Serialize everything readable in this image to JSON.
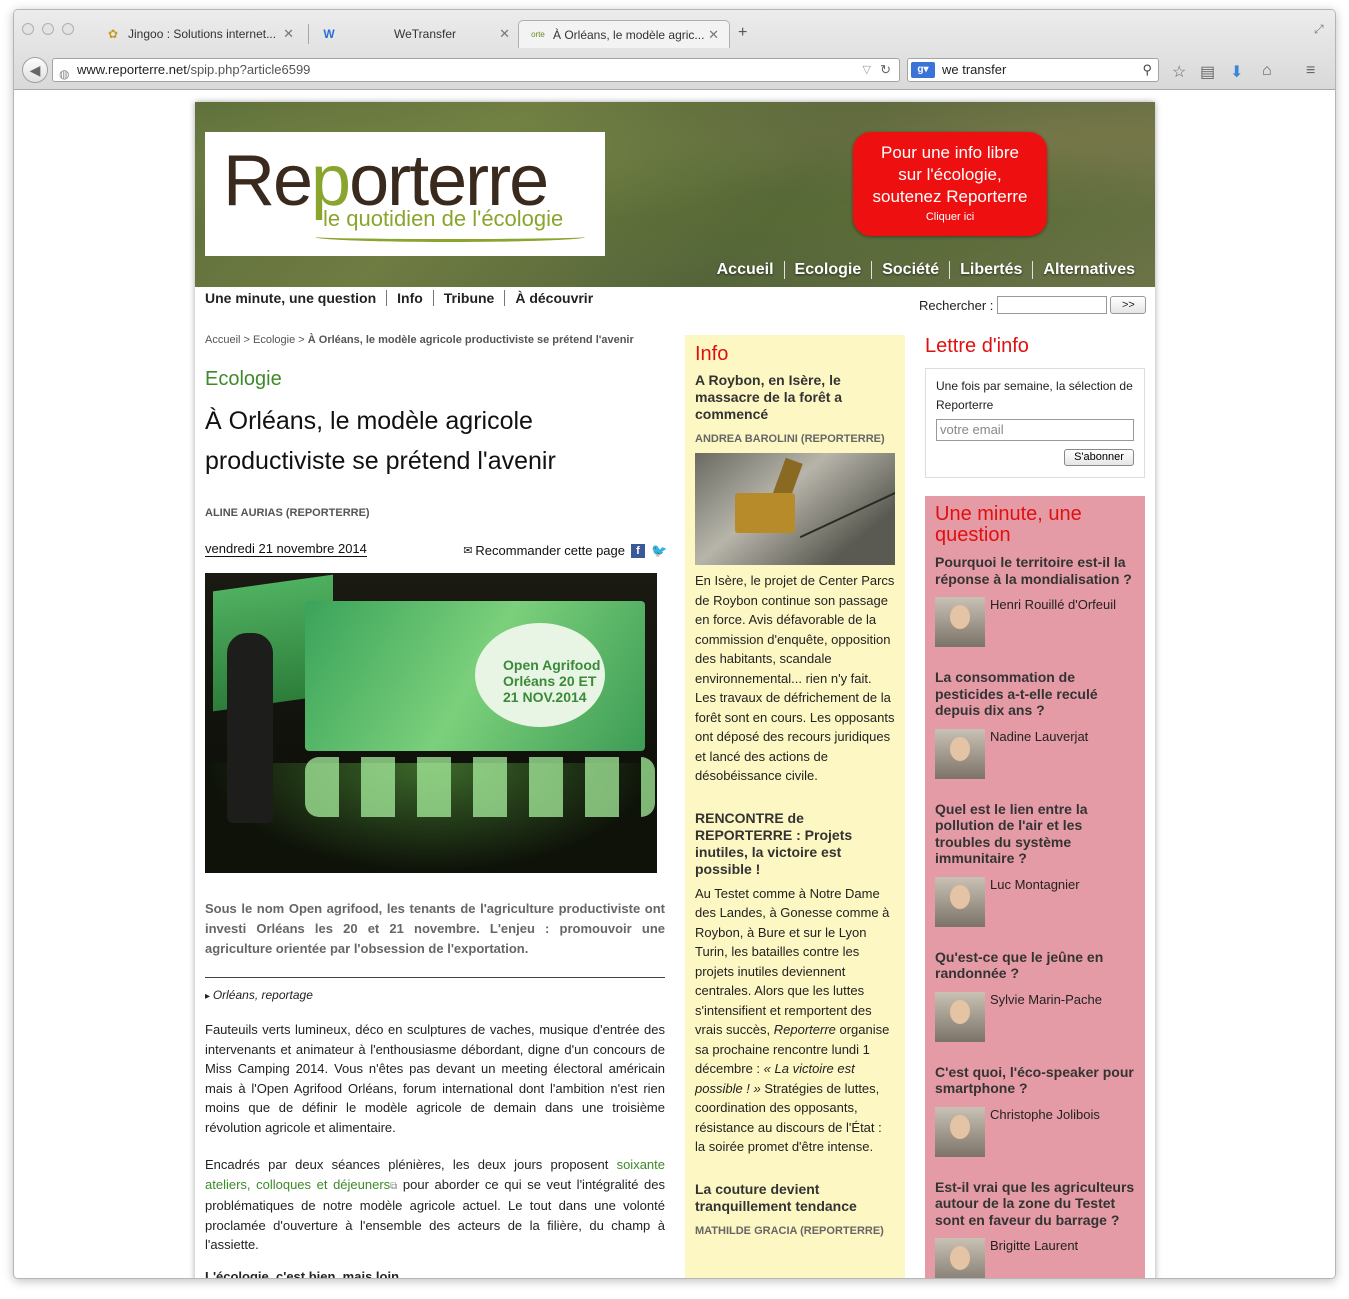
{
  "browser": {
    "tabs": [
      {
        "label": "Jingoo : Solutions internet...",
        "icon": "jingoo-icon"
      },
      {
        "label": "WeTransfer",
        "icon": "wetransfer-icon"
      },
      {
        "label": "À Orléans, le modèle agric...",
        "icon": "reporterre-icon"
      }
    ],
    "url_domain": "www.reporterre.net",
    "url_path": "/spip.php?article6599",
    "search_value": "we transfer"
  },
  "site": {
    "logo_main_1": "Re",
    "logo_main_2": "p",
    "logo_main_3": "orterre",
    "logo_tagline": "le quotidien de l'écologie",
    "support": {
      "line1": "Pour une info libre",
      "line2": "sur l'écologie,",
      "line3": "soutenez Reporterre",
      "cta": "Cliquer ici"
    },
    "main_nav": [
      "Accueil",
      "Ecologie",
      "Société",
      "Libertés",
      "Alternatives"
    ],
    "sub_nav": [
      "Une minute, une question",
      "Info",
      "Tribune",
      "À découvrir"
    ],
    "search_label": "Rechercher :",
    "search_go": ">>"
  },
  "article": {
    "breadcrumb_home": "Accueil",
    "breadcrumb_section": "Ecologie",
    "breadcrumb_current": "À Orléans, le modèle agricole productiviste se prétend l'avenir",
    "rubric": "Ecologie",
    "title": "À Orléans, le modèle agricole productiviste se prétend l'avenir",
    "author": "ALINE AURIAS (REPORTERRE)",
    "date": "vendredi 21 novembre 2014",
    "recommend": "Recommander cette page",
    "photo_screen_text": "Open Agrifood Orléans 20 ET 21 NOV.2014",
    "lead": "Sous le nom Open agrifood, les tenants de l'agriculture productiviste ont investi Orléans les 20 et 21 novembre. L'enjeu : promouvoir une agriculture orientée par l'obsession de l'exportation.",
    "location": "Orléans, reportage",
    "para1": "Fauteuils verts lumineux, déco en sculptures de vaches, musique d'entrée des intervenants et animateur à l'enthousiasme débordant, digne d'un concours de Miss Camping 2014. Vous n'êtes pas devant un meeting électoral américain mais à l'Open Agrifood Orléans, forum international dont l'ambition n'est rien moins que de définir le modèle agricole de demain dans une troisième révolution agricole et alimentaire.",
    "para2_a": "Encadrés par deux séances plénières, les deux jours proposent ",
    "para2_link": "soixante ateliers, colloques et déjeuners",
    "para2_b": " pour aborder ce qui se veut l'intégralité des problématiques de notre modèle agricole actuel. Le tout dans une volonté proclamée d'ouverture à l'ensemble des acteurs de la filière, du champ à l'assiette.",
    "subhead": "L'écologie, c'est bien, mais loin"
  },
  "info": {
    "heading": "Info",
    "items": [
      {
        "title": "A Roybon, en Isère, le massacre de la forêt a commencé",
        "author": "ANDREA BAROLINI (REPORTERRE)",
        "text": "En Isère, le projet de Center Parcs de Roybon continue son passage en force. Avis défavorable de la commission d'enquête, opposition des habitants, scandale environnemental... rien n'y fait. Les travaux de défrichement de la forêt sont en cours. Les opposants ont déposé des recours juridiques et lancé des actions de désobéissance civile."
      },
      {
        "title": "RENCONTRE de REPORTERRE : Projets inutiles, la victoire est possible !",
        "text_a": "Au Testet comme à Notre Dame des Landes, à Gonesse comme à Roybon, à Bure et sur le Lyon Turin, les batailles contre les projets inutiles deviennent centrales. Alors que les luttes s'intensifient et remportent des vrais succès, ",
        "text_em": "Reporterre",
        "text_b": " organise sa prochaine rencontre lundi 1 décembre : ",
        "text_em2": "« La victoire est possible ! »",
        "text_c": " Stratégies de luttes, coordination des opposants, résistance au discours de l'État : la soirée promet d'être intense."
      },
      {
        "title": "La couture devient tranquillement tendance",
        "author": "MATHILDE GRACIA (REPORTERRE)"
      }
    ]
  },
  "newsletter": {
    "heading": "Lettre d'info",
    "text": "Une fois par semaine, la sélection de Reporterre",
    "placeholder": "votre email",
    "button": "S'abonner"
  },
  "minute": {
    "heading": "Une minute, une question",
    "questions": [
      {
        "q": "Pourquoi le territoire est-il la réponse à la mondialisation ?",
        "name": "Henri Rouillé d'Orfeuil"
      },
      {
        "q": "La consommation de pesticides a-t-elle reculé depuis dix ans ?",
        "name": "Nadine Lauverjat"
      },
      {
        "q": "Quel est le lien entre la pollution de l'air et les troubles du système immunitaire ?",
        "name": "Luc Montagnier"
      },
      {
        "q": "Qu'est-ce que le jeûne en randonnée ?",
        "name": "Sylvie Marin-Pache"
      },
      {
        "q": "C'est quoi, l'éco-speaker pour smartphone ?",
        "name": "Christophe Jolibois"
      },
      {
        "q": "Est-il vrai que les agriculteurs autour de la zone du Testet sont en faveur du barrage ?",
        "name": "Brigitte Laurent"
      }
    ]
  }
}
